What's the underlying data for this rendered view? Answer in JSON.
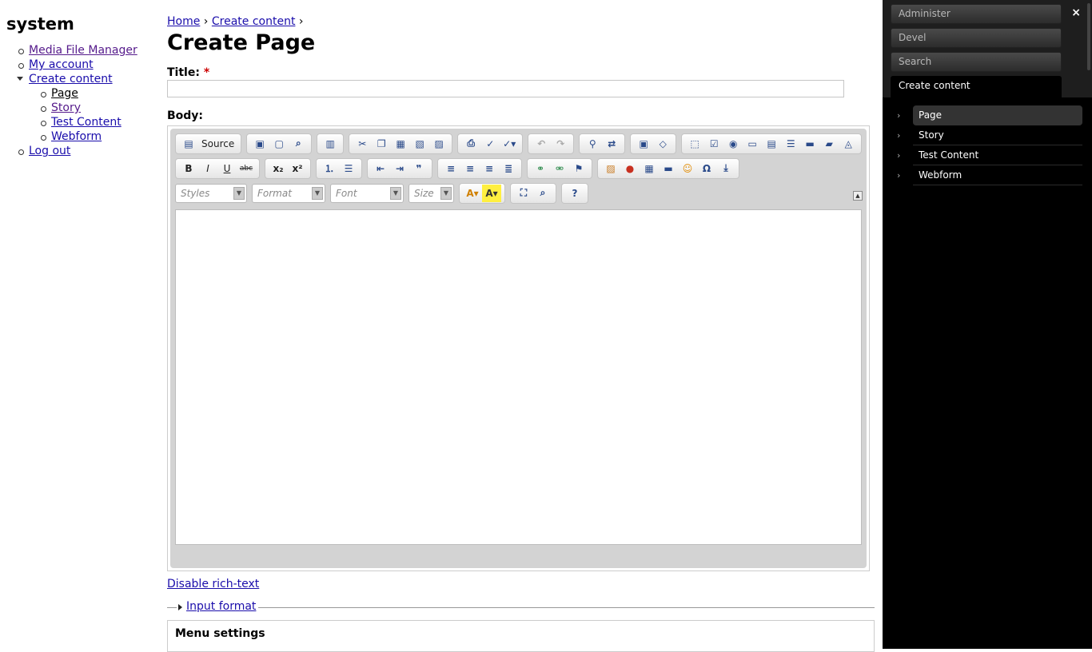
{
  "site": {
    "name": "system"
  },
  "nav": {
    "items": [
      {
        "label": "Media File Manager"
      },
      {
        "label": "My account"
      },
      {
        "label": "Create content"
      },
      {
        "label": "Log out"
      }
    ],
    "sub_items": [
      {
        "label": "Page"
      },
      {
        "label": "Story"
      },
      {
        "label": "Test Content"
      },
      {
        "label": "Webform"
      }
    ]
  },
  "breadcrumb": {
    "home": "Home",
    "create_content": "Create content",
    "separator": "›"
  },
  "page": {
    "title": "Create Page"
  },
  "form": {
    "title_label": "Title:",
    "required_mark": "*",
    "title_value": "",
    "body_label": "Body:"
  },
  "editor": {
    "source_label": "Source",
    "combos": {
      "styles": "Styles",
      "format": "Format",
      "font": "Font",
      "size": "Size"
    },
    "disable_rich_text": "Disable rich-text"
  },
  "input_format": {
    "label": "Input format"
  },
  "menu_settings": {
    "label": "Menu settings"
  },
  "admin": {
    "tabs": [
      {
        "label": "Administer"
      },
      {
        "label": "Devel"
      },
      {
        "label": "Search"
      },
      {
        "label": "Create content"
      }
    ],
    "close_label": "×",
    "menu_items": [
      {
        "label": "Page"
      },
      {
        "label": "Story"
      },
      {
        "label": "Test Content"
      },
      {
        "label": "Webform"
      }
    ]
  }
}
